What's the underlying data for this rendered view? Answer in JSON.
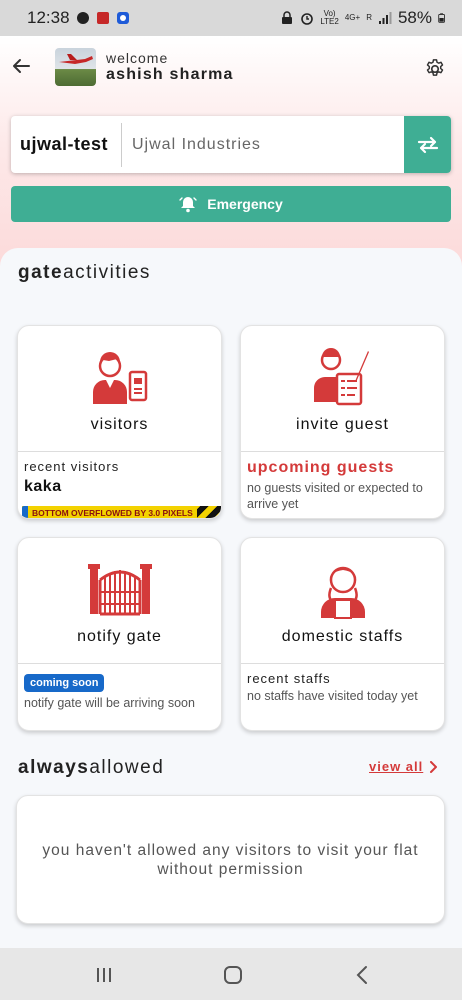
{
  "status_bar": {
    "time": "12:38",
    "net_label_1": "Vo)",
    "net_label_2": "LTE2",
    "net_label_3": "4G+",
    "net_label_4": "R",
    "battery": "58%"
  },
  "header": {
    "welcome": "welcome",
    "user_name": "ashish sharma"
  },
  "society": {
    "code": "ujwal-test",
    "name": "Ujwal Industries"
  },
  "emergency": {
    "label": "Emergency"
  },
  "gate_activities": {
    "title_bold": "gate",
    "title_rest": "activities"
  },
  "cards": {
    "visitors": {
      "title": "visitors",
      "label": "recent visitors",
      "name": "kaka",
      "overflow": "BOTTOM OVERFLOWED BY 3.0 PIXELS"
    },
    "invite": {
      "title": "invite guest",
      "label": "upcoming guests",
      "text": "no guests visited or expected to arrive yet"
    },
    "notify": {
      "title": "notify gate",
      "badge": "coming soon",
      "text": "notify gate will be arriving soon"
    },
    "staffs": {
      "title": "domestic staffs",
      "label": "recent staffs",
      "text": "no staffs have visited today yet"
    }
  },
  "always_allowed": {
    "title_bold": "always",
    "title_rest": "allowed",
    "view_all": "view all",
    "empty_message": "you haven't allowed any visitors to visit your flat without permission"
  },
  "colors": {
    "accent": "#3fae94",
    "red": "#d43a3a",
    "blue": "#1769c9"
  },
  "icons": [
    "back-arrow-icon",
    "gear-icon",
    "swap-icon",
    "bell-icon",
    "chevron-right-icon",
    "visitor-icon",
    "invite-icon",
    "gate-icon",
    "staff-icon"
  ]
}
